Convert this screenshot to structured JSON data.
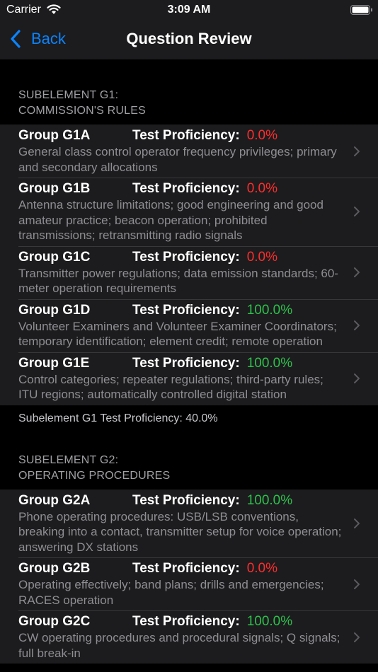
{
  "status_bar": {
    "carrier": "Carrier",
    "time": "3:09 AM"
  },
  "nav": {
    "back_label": "Back",
    "title": "Question Review"
  },
  "proficiency_label": "Test Proficiency:",
  "colors": {
    "accent": "#0a84ff",
    "fail": "#ff2d2d",
    "pass": "#2dc24b"
  },
  "sections": [
    {
      "header_line1": "SUBELEMENT G1:",
      "header_line2": "COMMISSION'S RULES",
      "groups": [
        {
          "name": "Group G1A",
          "proficiency": "0.0%",
          "status": "fail",
          "description": "General class control operator frequency privileges; primary and secondary allocations"
        },
        {
          "name": "Group G1B",
          "proficiency": "0.0%",
          "status": "fail",
          "description": "Antenna structure limitations; good engineering and good amateur practice; beacon operation; prohibited transmissions; retransmitting radio signals"
        },
        {
          "name": "Group G1C",
          "proficiency": "0.0%",
          "status": "fail",
          "description": "Transmitter power regulations; data emission standards; 60-meter operation requirements"
        },
        {
          "name": "Group G1D",
          "proficiency": "100.0%",
          "status": "pass",
          "description": "Volunteer Examiners and Volunteer Examiner Coordinators; temporary identification; element credit; remote operation"
        },
        {
          "name": "Group G1E",
          "proficiency": "100.0%",
          "status": "pass",
          "description": "Control categories; repeater regulations; third-party rules; ITU regions; automatically controlled digital station"
        }
      ],
      "footer": "Subelement G1 Test Proficiency:  40.0%"
    },
    {
      "header_line1": "SUBELEMENT G2:",
      "header_line2": "OPERATING PROCEDURES",
      "groups": [
        {
          "name": "Group G2A",
          "proficiency": "100.0%",
          "status": "pass",
          "description": "Phone operating procedures: USB/LSB conventions, breaking into a contact, transmitter setup for voice operation; answering DX stations"
        },
        {
          "name": "Group G2B",
          "proficiency": "0.0%",
          "status": "fail",
          "description": "Operating effectively; band plans; drills and emergencies; RACES operation"
        },
        {
          "name": "Group G2C",
          "proficiency": "100.0%",
          "status": "pass",
          "description": "CW operating procedures and procedural signals; Q signals; full break-in"
        }
      ]
    }
  ]
}
